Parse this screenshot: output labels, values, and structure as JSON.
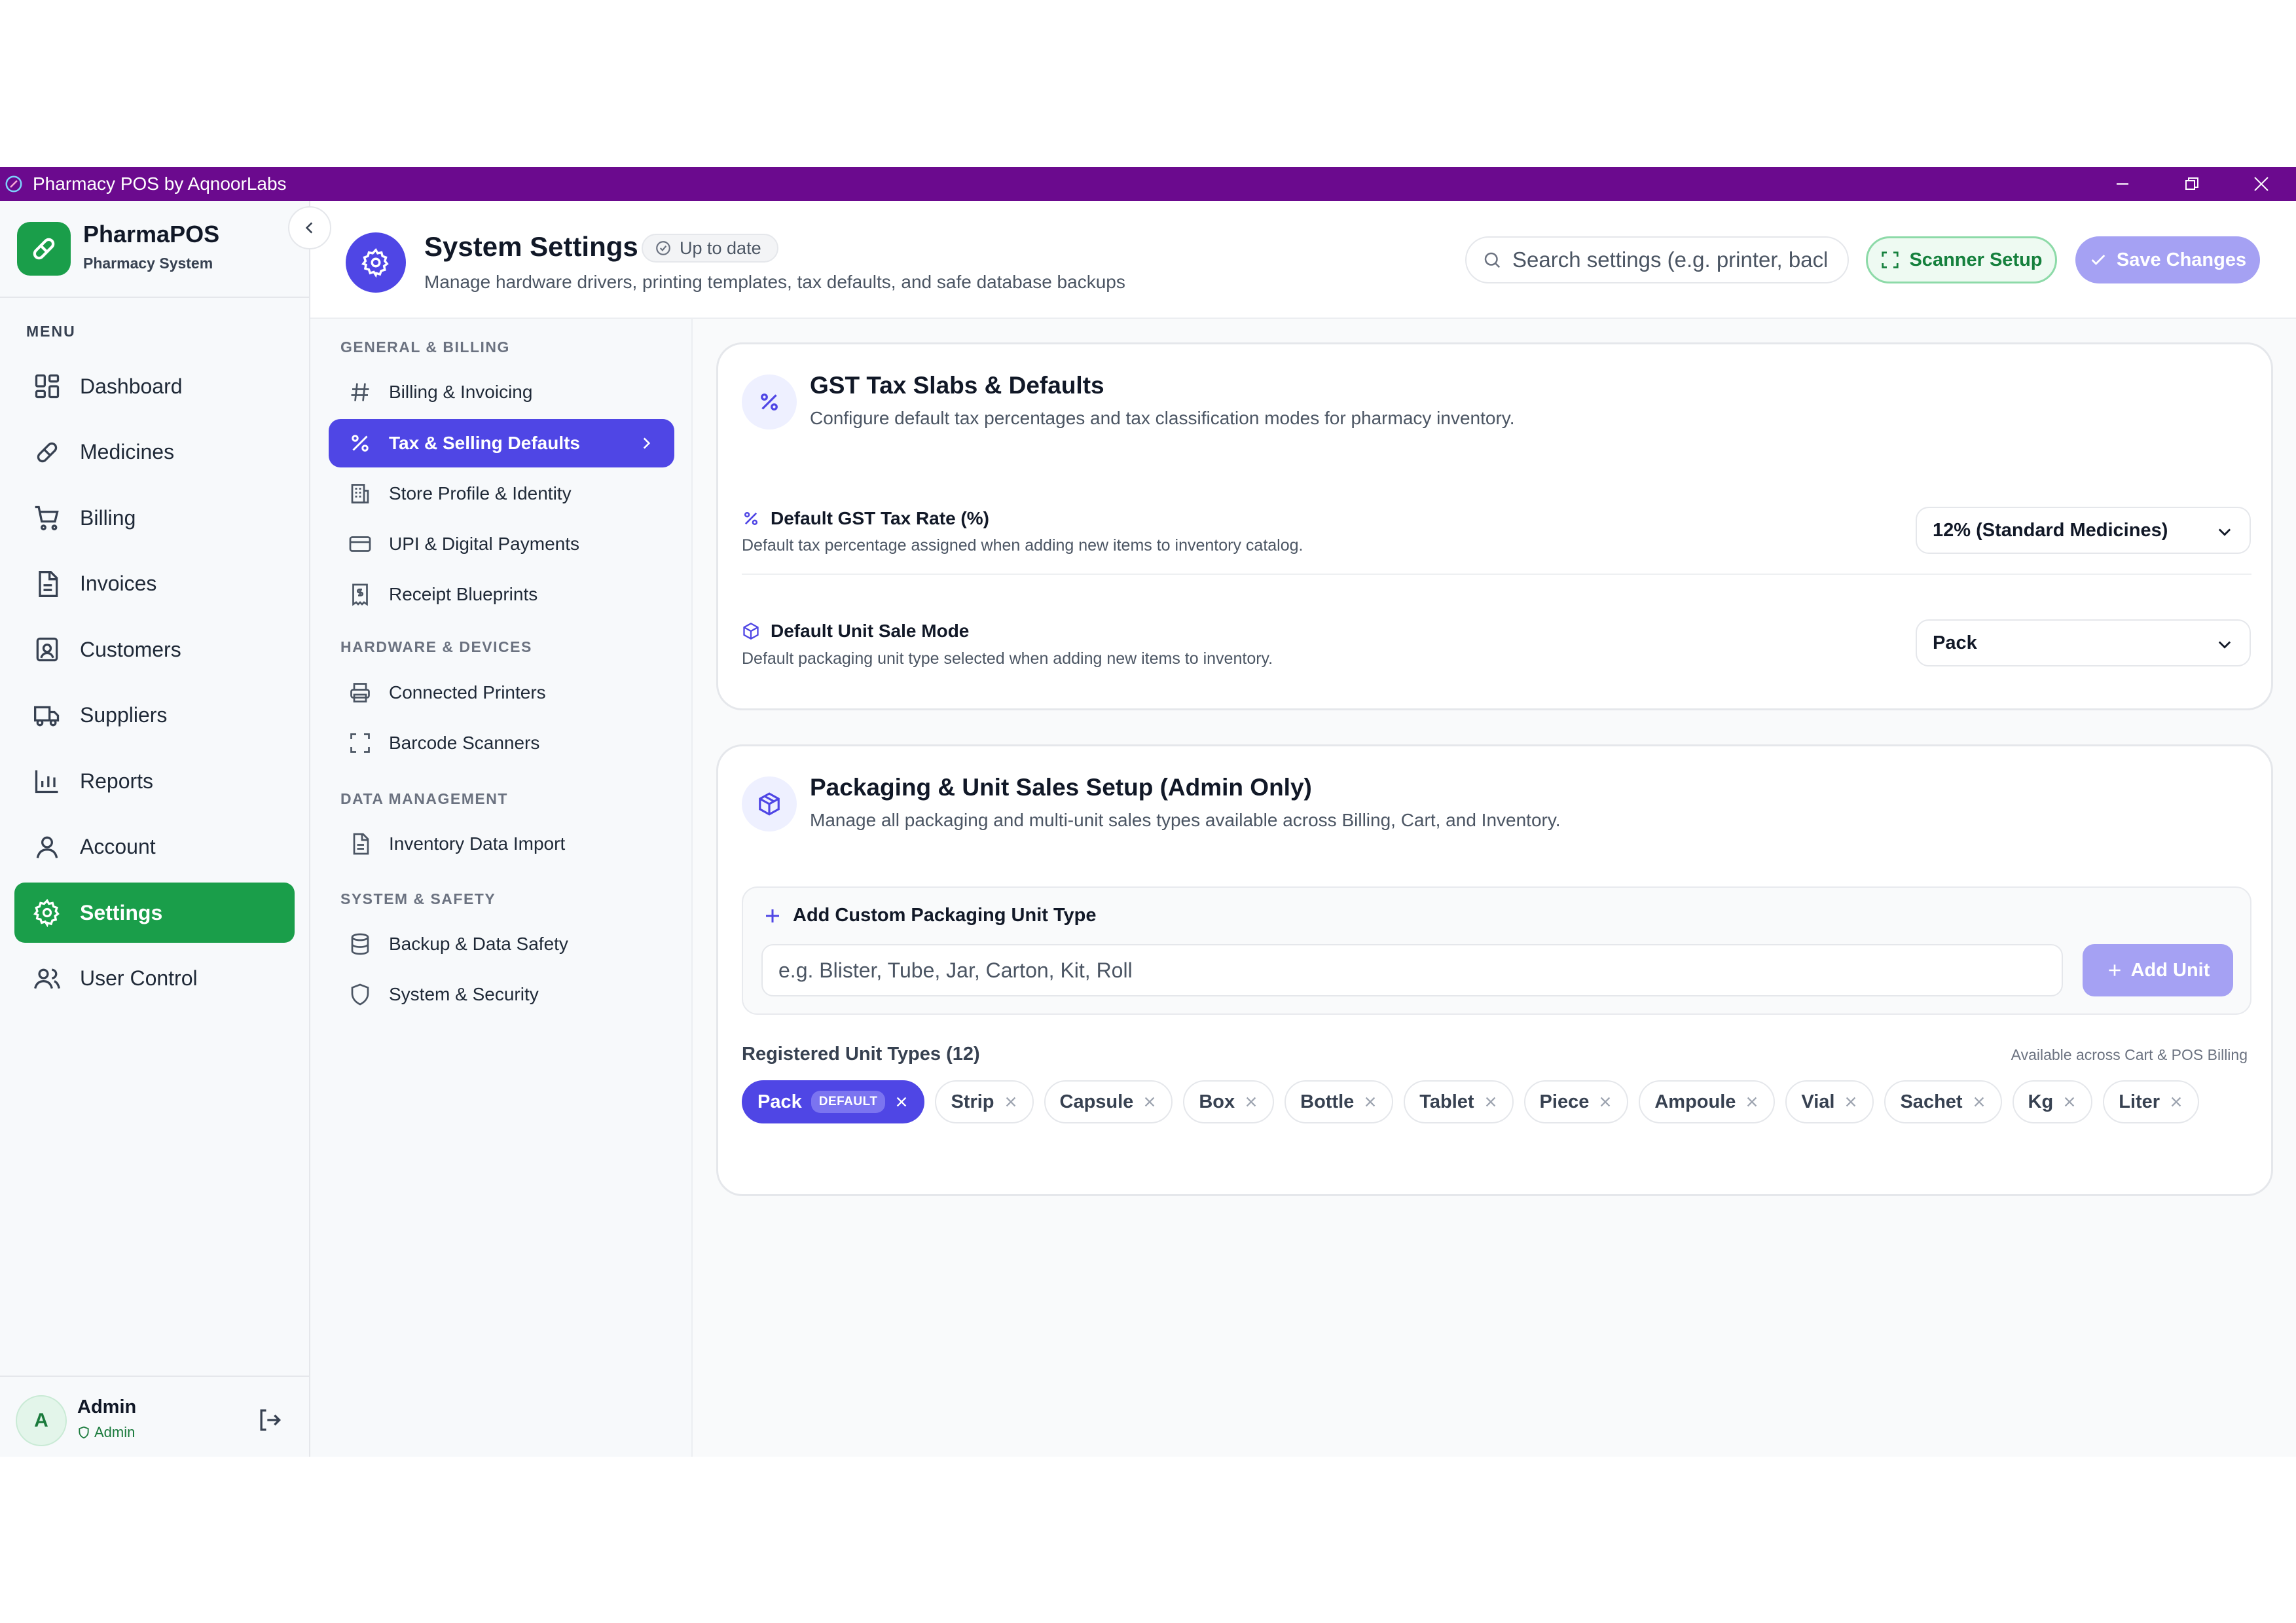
{
  "window": {
    "title": "Pharmacy POS by AqnoorLabs"
  },
  "brand": {
    "name": "PharmaPOS",
    "subtitle": "Pharmacy System"
  },
  "sidebar": {
    "menu_label": "MENU",
    "items": [
      {
        "label": "Dashboard",
        "icon": "dashboard-icon"
      },
      {
        "label": "Medicines",
        "icon": "pill-icon"
      },
      {
        "label": "Billing",
        "icon": "cart-icon"
      },
      {
        "label": "Invoices",
        "icon": "document-icon"
      },
      {
        "label": "Customers",
        "icon": "contact-card-icon"
      },
      {
        "label": "Suppliers",
        "icon": "truck-icon"
      },
      {
        "label": "Reports",
        "icon": "bar-chart-icon"
      },
      {
        "label": "Account",
        "icon": "user-icon"
      },
      {
        "label": "Settings",
        "icon": "gear-icon",
        "active": true
      },
      {
        "label": "User Control",
        "icon": "users-icon"
      }
    ]
  },
  "user": {
    "initial": "A",
    "name": "Admin",
    "role": "Admin"
  },
  "header": {
    "title": "System Settings",
    "status": "Up to date",
    "subtitle": "Manage hardware drivers, printing templates, tax defaults, and safe database backups",
    "search_placeholder": "Search settings (e.g. printer, backup)",
    "scanner_label": "Scanner Setup",
    "save_label": "Save Changes"
  },
  "settings_nav": {
    "sections": [
      {
        "title": "GENERAL & BILLING",
        "items": [
          {
            "label": "Billing & Invoicing",
            "icon": "hash-icon"
          },
          {
            "label": "Tax & Selling Defaults",
            "icon": "percent-icon",
            "active": true
          },
          {
            "label": "Store Profile & Identity",
            "icon": "building-icon"
          },
          {
            "label": "UPI & Digital Payments",
            "icon": "credit-card-icon"
          },
          {
            "label": "Receipt Blueprints",
            "icon": "receipt-icon"
          }
        ]
      },
      {
        "title": "HARDWARE & DEVICES",
        "items": [
          {
            "label": "Connected Printers",
            "icon": "printer-icon"
          },
          {
            "label": "Barcode Scanners",
            "icon": "scan-icon"
          }
        ]
      },
      {
        "title": "DATA MANAGEMENT",
        "items": [
          {
            "label": "Inventory Data Import",
            "icon": "file-icon"
          }
        ]
      },
      {
        "title": "SYSTEM & SAFETY",
        "items": [
          {
            "label": "Backup & Data Safety",
            "icon": "database-icon"
          },
          {
            "label": "System & Security",
            "icon": "shield-icon"
          }
        ]
      }
    ]
  },
  "gst_card": {
    "title": "GST Tax Slabs & Defaults",
    "subtitle": "Configure default tax percentages and tax classification modes for pharmacy inventory.",
    "rows": [
      {
        "label": "Default GST Tax Rate (%)",
        "desc": "Default tax percentage assigned when adding new items to inventory catalog.",
        "value": "12% (Standard Medicines)"
      },
      {
        "label": "Default Unit Sale Mode",
        "desc": "Default packaging unit type selected when adding new items to inventory.",
        "value": "Pack"
      }
    ]
  },
  "packaging_card": {
    "title": "Packaging & Unit Sales Setup (Admin Only)",
    "subtitle": "Manage all packaging and multi-unit sales types available across Billing, Cart, and Inventory.",
    "add_label": "Add Custom Packaging Unit Type",
    "add_placeholder": "e.g. Blister, Tube, Jar, Carton, Kit, Roll",
    "add_button": "Add Unit",
    "registered_label": "Registered Unit Types (12)",
    "registered_note": "Available across Cart & POS Billing",
    "default_tag": "DEFAULT",
    "units": [
      "Pack",
      "Strip",
      "Capsule",
      "Box",
      "Bottle",
      "Tablet",
      "Piece",
      "Ampoule",
      "Vial",
      "Sachet",
      "Kg",
      "Liter"
    ]
  },
  "colors": {
    "brand_green": "#1a9e4a",
    "accent_indigo": "#4f46e5",
    "titlebar": "#6b0a8e"
  }
}
